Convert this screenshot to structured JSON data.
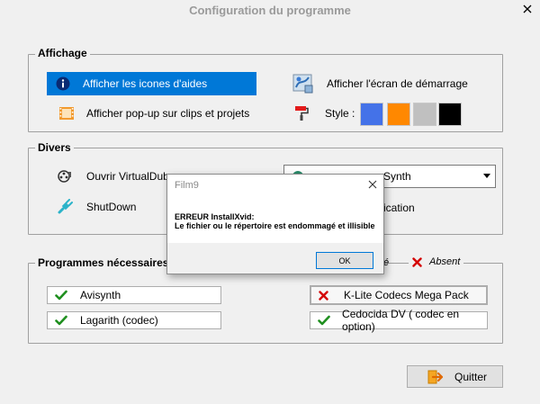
{
  "window": {
    "title": "Configuration du programme"
  },
  "affichage": {
    "label": "Affichage",
    "show_help_icons": "Afficher les icones d'aides",
    "show_popup": "Afficher pop-up sur clips et projets",
    "show_splash": "Afficher l'écran de démarrage",
    "style_label": "Style :",
    "style_colors": [
      "#4472e8",
      "#ff8800",
      "#c0c0c0",
      "#000000"
    ]
  },
  "divers": {
    "label": "Divers",
    "open_virtualdub": "Ouvrir VirtualDub",
    "shutdown": "ShutDown",
    "combo_value": "Synth",
    "application_text": "ication"
  },
  "programmes": {
    "label": "Programmes nécessaires au fo",
    "legend_present_suffix": "é",
    "legend_absent": "Absent",
    "items": [
      {
        "label": "Avisynth",
        "status": "present"
      },
      {
        "label": "K-Lite Codecs Mega Pack",
        "status": "absent"
      },
      {
        "label": "Lagarith (codec)",
        "status": "present"
      },
      {
        "label": "Cedocida DV ( codec en option)",
        "status": "present"
      }
    ]
  },
  "quit_label": "Quitter",
  "dialog": {
    "title": "Film9",
    "line1": "ERREUR InstallXvid:",
    "line2": "Le fichier ou le répertoire est endommagé et illisible",
    "ok_label": "OK"
  }
}
